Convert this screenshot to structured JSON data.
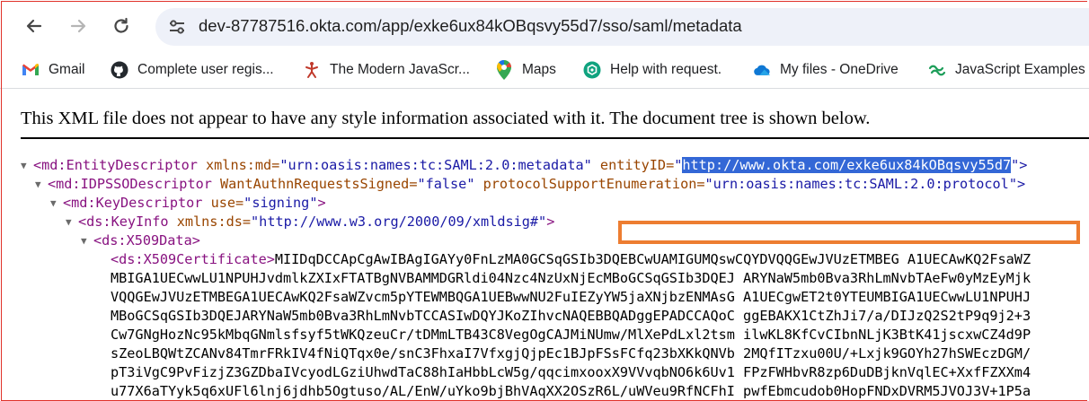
{
  "browser": {
    "url": "dev-87787516.okta.com/app/exke6ux84kOBqsvy55d7/sso/saml/metadata"
  },
  "bookmarks": [
    {
      "label": "Gmail",
      "icon": "gmail-icon"
    },
    {
      "label": "Complete user regis...",
      "icon": "github-icon"
    },
    {
      "label": "The Modern JavaScr...",
      "icon": "figure-icon"
    },
    {
      "label": "Maps",
      "icon": "maps-icon"
    },
    {
      "label": "Help with request.",
      "icon": "chatgpt-icon"
    },
    {
      "label": "My files - OneDrive",
      "icon": "onedrive-icon"
    },
    {
      "label": "JavaScript Examples",
      "icon": "link-icon"
    }
  ],
  "notice": "This XML file does not appear to have any style information associated with it. The document tree is shown below.",
  "xml": {
    "entity": {
      "tag": "<md:EntityDescriptor",
      "xmlns_attr": " xmlns:md=",
      "xmlns_val": "\"urn:oasis:names:tc:SAML:2.0:metadata\"",
      "entity_attr": " entityID=",
      "entity_q1": "\"",
      "entity_val": "http://www.okta.com/exke6ux84kOBqsvy55d7",
      "entity_q2": "\">"
    },
    "idp": {
      "tag": "<md:IDPSSODescriptor",
      "want_attr": " WantAuthnRequestsSigned=",
      "want_val": "\"false\"",
      "proto_attr": " protocolSupportEnumeration=",
      "proto_val": "\"urn:oasis:names:tc:SAML:2.0:protocol\">"
    },
    "keydesc": {
      "tag": "<md:KeyDescriptor",
      "use_attr": " use=",
      "use_val": "\"signing\"",
      "close": ">"
    },
    "keyinfo": {
      "tag": "<ds:KeyInfo",
      "ns_attr": " xmlns:ds=",
      "ns_val": "\"http://www.w3.org/2000/09/xmldsig#\"",
      "close": ">"
    },
    "x509data": "<ds:X509Data>",
    "x509cert_tag": "<ds:X509Certificate>",
    "cert_first": "MIIDqDCCApCgAwIBAgIGAYy0FnLzMA0GCSqGSIb3DQEBCwUAMIGUMQswCQYDVQQGEwJVUzETMBEG A1UECAwKQ2FsaWZ",
    "cert_lines": [
      "MBIGA1UECwwLU1NPUHJvdmlkZXIxFTATBgNVBAMMDGRldi04Nzc4NzUxNjEcMBoGCSqGSIb3DQEJ ARYNaW5mb0Bva3RhLmNvbTAeFw0yMzEyMjk",
      "VQQGEwJVUzETMBEGA1UECAwKQ2FsaWZvcm5pYTEWMBQGA1UEBwwNU2FuIEZyYW5jaXNjbzENMAsG A1UECgwET2t0YTEUMBIGA1UECwwLU1NPUHJ",
      "MBoGCSqGSIb3DQEJARYNaW5mb0Bva3RhLmNvbTCCASIwDQYJKoZIhvcNAQEBBQADggEPADCCAQoC ggEBAKX1CtZhJi7/a/DIJzQ2S2tP9q9j2+3",
      "Cw7GNgHozNc95kMbqGNmlsfsyf5tWKQzeuCr/tDMmLTB43C8VegOgCAJMiNUmw/MlXePdLxl2tsm ilwKL8KfCvCIbnNLjK3BtK41jscxwCZ4d9P",
      "sZeoLBQWtZCANv84TmrFRkIV4fNiQTqx0e/snC3FhxaI7VfxgjQjpEc1BJpFSsFCfq23bXKkQNVb 2MQfITzxu00U/+Lxjk9GOYh27hSWEczDGM/",
      "pT3iVgC9PvFizjZ3GZDbaIVcyodLGziUhwdTaC88hIaHbbLcW5g/qqcimxooxX9VVvqbNO6k6Uv1 FPzFWHbvR8zp6DuDBjknVqlEC+XxfFZXXm4",
      "u77X6aTYyk5q6xUFl6lnj6jdhb5Ogtuso/AL/EnW/uYko9bjBhVAqXX2OSzR6L/uWVeu9RfNCFhI pwfEbmcudob0HopFNDxDVRM5JVOJ3V+1P5a"
    ]
  }
}
